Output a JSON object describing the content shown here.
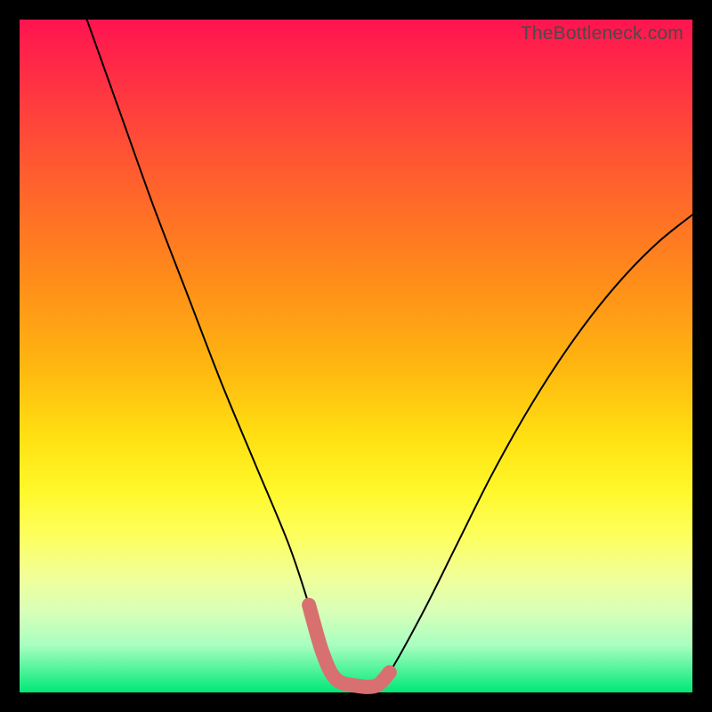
{
  "watermark": "TheBottleneck.com",
  "chart_data": {
    "type": "line",
    "title": "",
    "xlabel": "",
    "ylabel": "",
    "xlim": [
      0,
      100
    ],
    "ylim": [
      0,
      100
    ],
    "series": [
      {
        "name": "black-curve",
        "color": "#000000",
        "width": 2,
        "x": [
          10,
          15,
          20,
          25,
          30,
          35,
          40,
          43,
          45,
          47,
          50,
          53,
          55,
          60,
          65,
          70,
          75,
          80,
          85,
          90,
          95,
          100
        ],
        "values": [
          100,
          86,
          72,
          59,
          46,
          34,
          22,
          13,
          6,
          2,
          1,
          1,
          3,
          12,
          22,
          32,
          41,
          49,
          56,
          62,
          67,
          71
        ]
      },
      {
        "name": "pink-trough",
        "color": "#d8706f",
        "width": 10,
        "x": [
          43,
          45,
          47,
          50,
          53,
          55
        ],
        "values": [
          13,
          6,
          2,
          1,
          1,
          3
        ]
      }
    ]
  },
  "gradient_stops": [
    {
      "pos": 0,
      "color": "#ff1450"
    },
    {
      "pos": 8,
      "color": "#ff2d45"
    },
    {
      "pos": 22,
      "color": "#ff5a30"
    },
    {
      "pos": 38,
      "color": "#ff8a1a"
    },
    {
      "pos": 52,
      "color": "#ffb810"
    },
    {
      "pos": 62,
      "color": "#ffe012"
    },
    {
      "pos": 70,
      "color": "#fff82a"
    },
    {
      "pos": 77,
      "color": "#fdff60"
    },
    {
      "pos": 83,
      "color": "#f0ff9a"
    },
    {
      "pos": 88,
      "color": "#d8ffb8"
    },
    {
      "pos": 93,
      "color": "#a8ffc0"
    },
    {
      "pos": 100,
      "color": "#00e878"
    }
  ]
}
